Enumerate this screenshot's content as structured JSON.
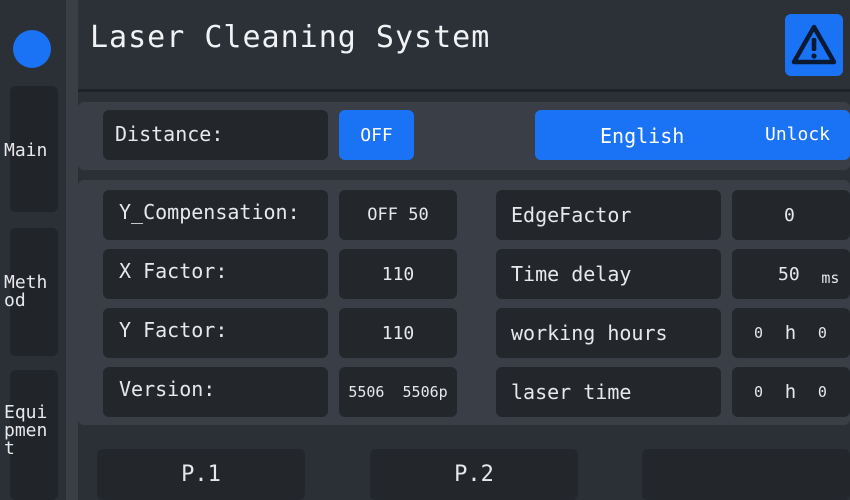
{
  "header": {
    "title": "Laser Cleaning System"
  },
  "sidebar": {
    "items": [
      {
        "label": "Main"
      },
      {
        "label": "Meth\nod"
      },
      {
        "label": "Equi\npmen\nt"
      }
    ]
  },
  "top_row": {
    "distance_label": "Distance:",
    "distance_value": "OFF",
    "language_label": "English",
    "lock_label": "Unlock"
  },
  "params_left": [
    {
      "label": "Y_Compensation:",
      "value_a": "OFF",
      "value_b": "50"
    },
    {
      "label": "X Factor:",
      "value": "110"
    },
    {
      "label": "Y Factor:",
      "value": "110"
    },
    {
      "label": "Version:",
      "value_a": "5506",
      "value_b": "5506p"
    }
  ],
  "params_right": [
    {
      "label": "EdgeFactor",
      "value": "0"
    },
    {
      "label": "Time delay",
      "value": "50",
      "unit": "ms"
    },
    {
      "label": "working hours",
      "value_a": "0",
      "unit": "h",
      "value_b": "0"
    },
    {
      "label": "laser time",
      "value_a": "0",
      "unit": "h",
      "value_b": "0"
    }
  ],
  "tabs": [
    {
      "label": "P.1"
    },
    {
      "label": "P.2"
    },
    {
      "label": ""
    }
  ],
  "colors": {
    "accent": "#1a73f5",
    "background": "#2b2f36",
    "cell": "#23272c",
    "panel": "#3a3f47"
  },
  "icons": {
    "status": "status-dot-icon",
    "alarm": "warning-triangle-icon"
  }
}
